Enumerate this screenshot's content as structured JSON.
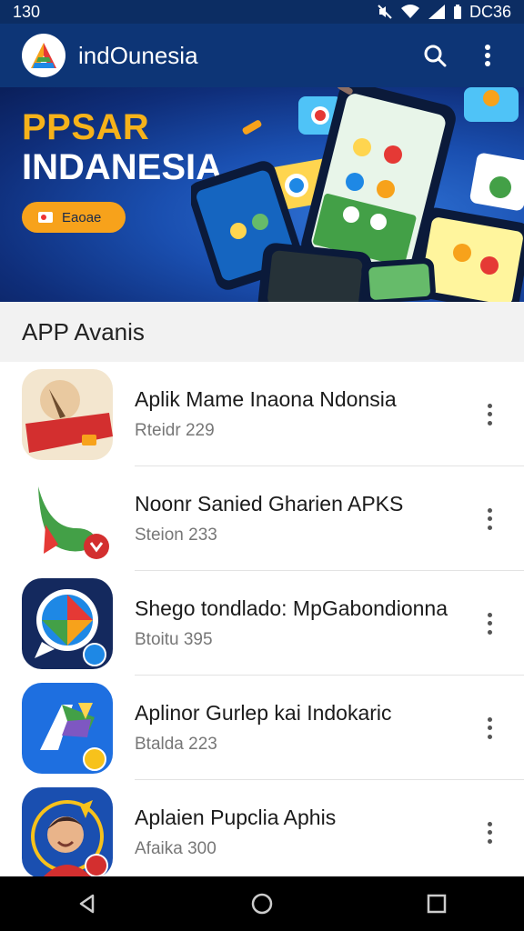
{
  "status_bar": {
    "time": "130",
    "battery": "DC36"
  },
  "app_bar": {
    "title": "indOunesia"
  },
  "banner": {
    "title_line1": "PPSAR",
    "title_line2": "INDANESIA",
    "button_label": "Eaoae"
  },
  "section": {
    "title": "APP Avanis"
  },
  "apps": [
    {
      "title": "Aplik Mame Inaona Ndonsia",
      "subtitle": "Rteidr 229",
      "icon": "red-ribbon-app-icon"
    },
    {
      "title": "Noonr Sanied Gharien APKS",
      "subtitle": "Steion 233",
      "icon": "green-leaf-app-icon"
    },
    {
      "title": "Shego tondlado: MpGabondionna",
      "subtitle": "Btoitu 395",
      "icon": "chat-bubble-app-icon"
    },
    {
      "title": "Aplinor Gurlep kai Indokaric",
      "subtitle": "Btalda 223",
      "icon": "colorful-a-app-icon"
    },
    {
      "title": "Aplaien Pupclia Aphis",
      "subtitle": "Afaika 300",
      "icon": "character-avatar-app-icon"
    }
  ],
  "colors": {
    "app_bar": "#0d3576",
    "accent": "#f7a21b",
    "banner": "#1a4fb0"
  }
}
